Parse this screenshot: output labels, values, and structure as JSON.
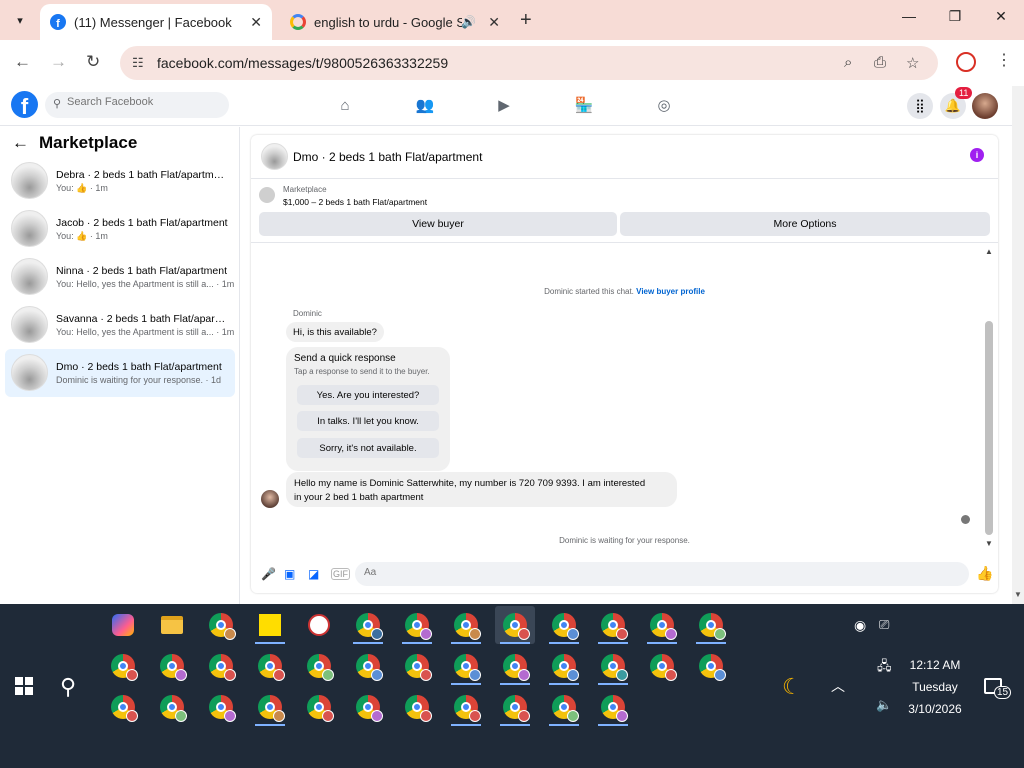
{
  "browser": {
    "tabs": [
      {
        "title": "(11) Messenger | Facebook",
        "active": true
      },
      {
        "title": "english to urdu - Google Se",
        "active": false
      }
    ],
    "url": "facebook.com/messages/t/9800526363332259"
  },
  "facebook_nav": {
    "search_placeholder": "Search Facebook",
    "notification_count": "11"
  },
  "sidebar": {
    "title": "Marketplace",
    "conversations": [
      {
        "name": "Debra · 2 beds 1 bath Flat/apartment",
        "preview": "You: 👍 · 1m",
        "selected": false
      },
      {
        "name": "Jacob · 2 beds 1 bath Flat/apartment",
        "preview": "You: 👍 · 1m",
        "selected": false
      },
      {
        "name": "Ninna · 2 beds 1 bath Flat/apartment",
        "preview": "You: Hello, yes the Apartment is still a... · 1m",
        "selected": false
      },
      {
        "name": "Savanna · 2 beds 1 bath Flat/apartment",
        "preview": "You: Hello, yes the Apartment is still a... · 1m",
        "selected": false
      },
      {
        "name": "Dmo · 2 beds 1 bath Flat/apartment",
        "preview": "Dominic is waiting for your response. · 1d",
        "selected": true
      }
    ]
  },
  "chat": {
    "header_name": "Dmo · 2 beds 1 bath Flat/apartment",
    "listing": {
      "source": "Marketplace",
      "price_title": "$1,000 – 2 beds 1 bath Flat/apartment",
      "view_buyer": "View buyer",
      "more_options": "More Options"
    },
    "started_text": "Dominic started this chat.",
    "view_profile": "View buyer profile",
    "sender_name": "Dominic",
    "message1": "Hi, is this available?",
    "quick_response": {
      "title": "Send a quick response",
      "subtitle": "Tap a response to send it to the buyer.",
      "options": [
        "Yes. Are you interested?",
        "In talks. I'll let you know.",
        "Sorry, it's not available."
      ]
    },
    "message2_line1": "Hello my name is Dominic Satterwhite, my number is 720 709 9393. I am interested",
    "message2_line2": "in your 2 bed 1 bath apartment",
    "waiting_text": "Dominic is waiting for your response.",
    "composer_placeholder": "Aa"
  },
  "taskbar": {
    "time": "12:12 AM",
    "day": "Tuesday",
    "date": "3/10/2026",
    "notification_count": "15"
  }
}
